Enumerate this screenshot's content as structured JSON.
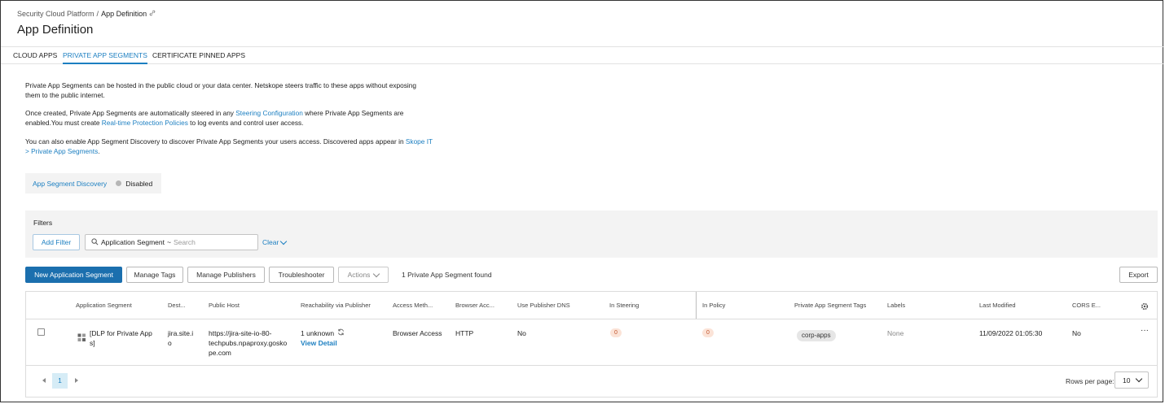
{
  "breadcrumb": {
    "root": "Security Cloud Platform",
    "separator": "/",
    "current": "App Definition"
  },
  "page_title": "App Definition",
  "tabs": [
    {
      "label": "CLOUD APPS",
      "active": false
    },
    {
      "label": "PRIVATE APP SEGMENTS",
      "active": true
    },
    {
      "label": "CERTIFICATE PINNED APPS",
      "active": false
    }
  ],
  "intro": {
    "p1": "Private App Segments can be hosted in the public cloud or your data center. Netskope steers traffic to these apps without exposing them to the public internet.",
    "p2_a": "Once created, Private App Segments are automatically steered in any ",
    "p2_link1": "Steering Configuration",
    "p2_b": " where Private App Segments are enabled.You must create ",
    "p2_link2": "Real-time Protection Policies",
    "p2_c": " to log events and control user access.",
    "p3_a": "You can also enable App Segment Discovery to discover Private App Segments your users access. Discovered apps appear in ",
    "p3_link": "Skope IT > Private App Segments",
    "p3_b": "."
  },
  "discovery": {
    "label": "App Segment Discovery",
    "status": "Disabled",
    "status_color": "#b6b6b6"
  },
  "filters": {
    "title": "Filters",
    "add_filter": "Add Filter",
    "field": "Application Segment",
    "operator": "~",
    "placeholder": "Search",
    "clear": "Clear"
  },
  "toolbar": {
    "new_segment": "New Application Segment",
    "manage_tags": "Manage Tags",
    "manage_publishers": "Manage Publishers",
    "troubleshooter": "Troubleshooter",
    "actions": "Actions",
    "found": "1 Private App Segment found",
    "export": "Export"
  },
  "table": {
    "columns": [
      "Application Segment",
      "Dest...",
      "Public Host",
      "Reachability via Publisher",
      "Access Meth...",
      "Browser Acc...",
      "Use Publisher DNS",
      "In Steering",
      "In Policy",
      "Private App Segment Tags",
      "Labels",
      "Last Modified",
      "CORS E..."
    ],
    "rows": [
      {
        "segment_l1": "[DLP for Private App",
        "segment_l2": "s]",
        "dest_l1": "jira.site.i",
        "dest_l2": "o",
        "host_l1": "https://jira-site-io-80-",
        "host_l2": "techpubs.npaproxy.gosko",
        "host_l3": "pe.com",
        "reachability": "1 unknown",
        "view_detail": "View Detail",
        "access": "Browser Access",
        "browser": "HTTP",
        "dns": "No",
        "steering": "0",
        "policy": "0",
        "tag": "corp-apps",
        "labels": "None",
        "modified": "11/09/2022 01:05:30",
        "cors": "No",
        "more": "···"
      }
    ]
  },
  "pagination": {
    "current_page": "1",
    "rows_label": "Rows per page:",
    "rows_value": "10"
  },
  "colors": {
    "accent": "#1c7fc1",
    "primary_button": "#1b6fae",
    "badge_bg": "#fbe3d7",
    "badge_fg": "#c0522a"
  }
}
